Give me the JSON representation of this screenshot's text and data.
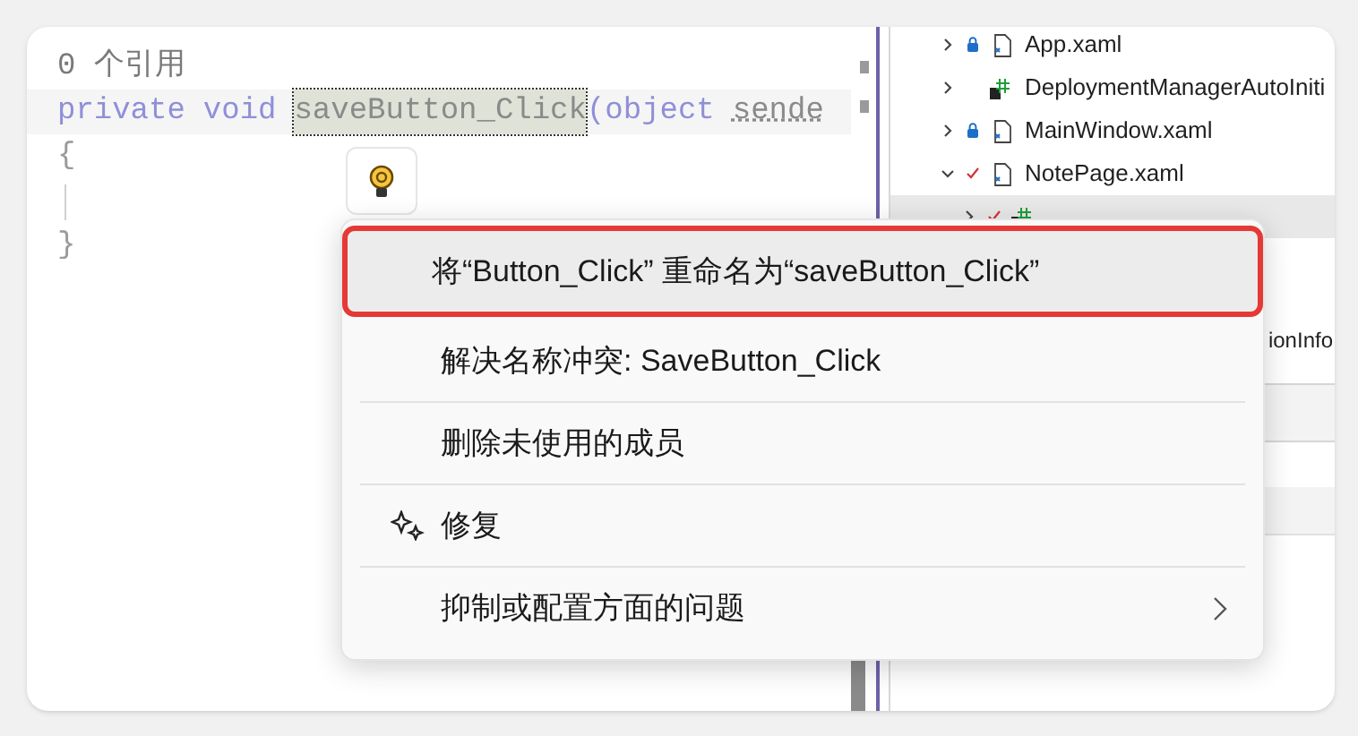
{
  "editor": {
    "reference_count": "0 个引用",
    "lines": [
      {
        "kind": "signature",
        "tokens": [
          {
            "kind": "keyword",
            "text": "private"
          },
          {
            "kind": "keyword",
            "text": "void"
          },
          {
            "kind": "renamed",
            "text": "saveButton_Click"
          },
          {
            "kind": "plain",
            "text": "(object"
          },
          {
            "kind": "hint",
            "text": "sende"
          }
        ]
      },
      {
        "kind": "code",
        "text": "{"
      },
      {
        "kind": "guide"
      },
      {
        "kind": "code",
        "text": "}"
      }
    ]
  },
  "solution_explorer": {
    "items": [
      {
        "label": "App.xaml",
        "kind": "xaml",
        "locked": true,
        "checked": false,
        "expanded": false
      },
      {
        "label": "DeploymentManagerAutoIniti",
        "kind": "csharp",
        "locked": false,
        "checked": false,
        "expanded": false
      },
      {
        "label": "MainWindow.xaml",
        "kind": "xaml",
        "locked": true,
        "checked": false,
        "expanded": false
      },
      {
        "label": "NotePage.xaml",
        "kind": "xaml",
        "locked": false,
        "checked": true,
        "expanded": true,
        "children": [
          {
            "kind": "csharp",
            "locked": false,
            "checked": true,
            "selected": true
          }
        ]
      }
    ],
    "partial_item": "ionInfo"
  },
  "context_menu": {
    "items": [
      {
        "label": "将“Button_Click” 重命名为“saveButton_Click”",
        "selected": true,
        "annotated": true,
        "kind": "plain",
        "submenu": false
      },
      {
        "label": "解决名称冲突: SaveButton_Click",
        "selected": false,
        "annotated": false,
        "kind": "plain",
        "submenu": false
      },
      {
        "label": "删除未使用的成员",
        "selected": false,
        "annotated": false,
        "kind": "plain",
        "submenu": false
      },
      {
        "label": "修复",
        "selected": false,
        "annotated": false,
        "kind": "sparkle",
        "submenu": false
      },
      {
        "label": "抑制或配置方面的问题",
        "selected": false,
        "annotated": false,
        "kind": "plain",
        "submenu": true
      }
    ]
  }
}
